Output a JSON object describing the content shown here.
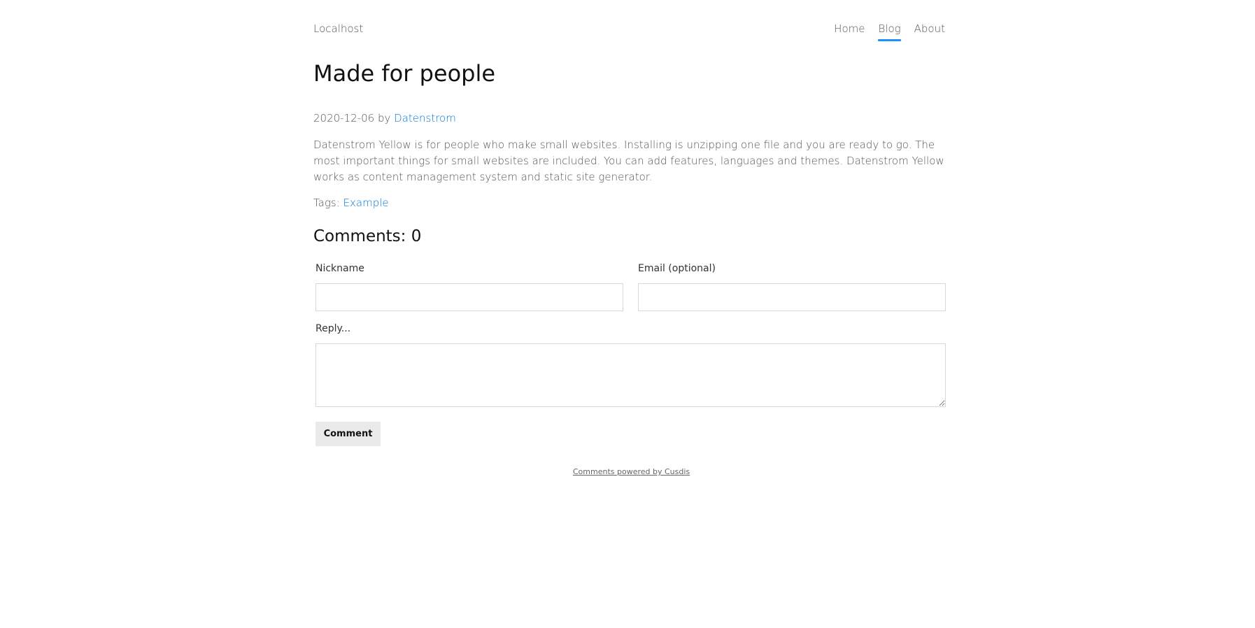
{
  "header": {
    "site_title": "Localhost",
    "nav": [
      {
        "label": "Home"
      },
      {
        "label": "Blog"
      },
      {
        "label": "About"
      }
    ]
  },
  "post": {
    "title": "Made for people",
    "date": "2020-12-06",
    "by": "by",
    "author": "Datenstrom",
    "body": "Datenstrom Yellow is for people who make small websites. Installing is unzipping one file and you are ready to go. The most important things for small websites are included. You can add features, languages and themes. Datenstrom Yellow works as content management system and static site generator.",
    "tags_label": "Tags:",
    "tag": "Example"
  },
  "comments": {
    "title": "Comments: 0",
    "nickname_label": "Nickname",
    "email_label": "Email (optional)",
    "reply_label": "Reply...",
    "nickname_value": "",
    "email_value": "",
    "reply_value": "",
    "submit_label": "Comment",
    "powered_by": "Comments powered by Cusdis"
  },
  "colors": {
    "link": "#0077dd",
    "nav_active_underline": "#1e90ff"
  }
}
